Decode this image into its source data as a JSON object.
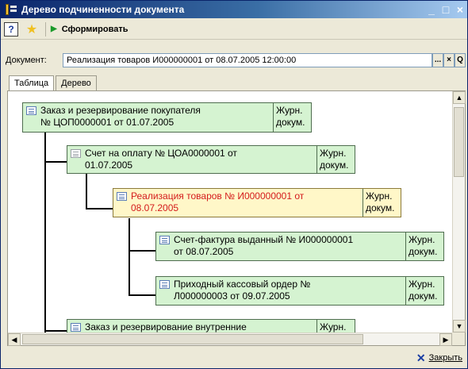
{
  "window": {
    "title": "Дерево подчиненности документа",
    "min_glyph": "_",
    "max_glyph": "□",
    "close_glyph": "×"
  },
  "toolbar": {
    "help_label": "?",
    "star_glyph": "★",
    "form_label": "Сформировать",
    "play_glyph": "▶"
  },
  "document": {
    "label": "Документ:",
    "value": "Реализация товаров И000000001 от 08.07.2005 12:00:00",
    "select_label": "...",
    "clear_label": "×",
    "open_label": "Q"
  },
  "tabs": [
    {
      "label": "Таблица",
      "active": true
    },
    {
      "label": "Дерево",
      "active": false
    }
  ],
  "tree": {
    "nodes": [
      {
        "text": "Заказ и резервирование покупателя\n№ ЦОП0000001 от 01.07.2005",
        "journal": "Журн.\nдокум.",
        "icon": "document-icon"
      },
      {
        "text": "Счет на оплату № ЦОА0000001 от\n01.07.2005",
        "journal": "Журн.\nдокум.",
        "icon": "document-grey-icon"
      },
      {
        "text": "Реализация товаров № И000000001 от\n08.07.2005",
        "journal": "Журн.\nдокум.",
        "icon": "document-icon"
      },
      {
        "text": "Счет-фактура выданный № И000000001\nот 08.07.2005",
        "journal": "Журн.\nдокум.",
        "icon": "document-icon"
      },
      {
        "text": "Приходный кассовый ордер №\nЛ000000003 от 09.07.2005",
        "journal": "Журн.\nдокум.",
        "icon": "document-icon"
      },
      {
        "text": "Заказ и резервирование внутренние",
        "journal": "Журн.",
        "icon": "document-icon"
      }
    ]
  },
  "footer": {
    "close_label": "Закрыть",
    "close_glyph": "✕"
  },
  "colors": {
    "node_fill": "#d5f3d1",
    "current_node_fill": "#fff7c8",
    "current_node_text": "#d41b1b",
    "title_bar": "#0a246a"
  }
}
